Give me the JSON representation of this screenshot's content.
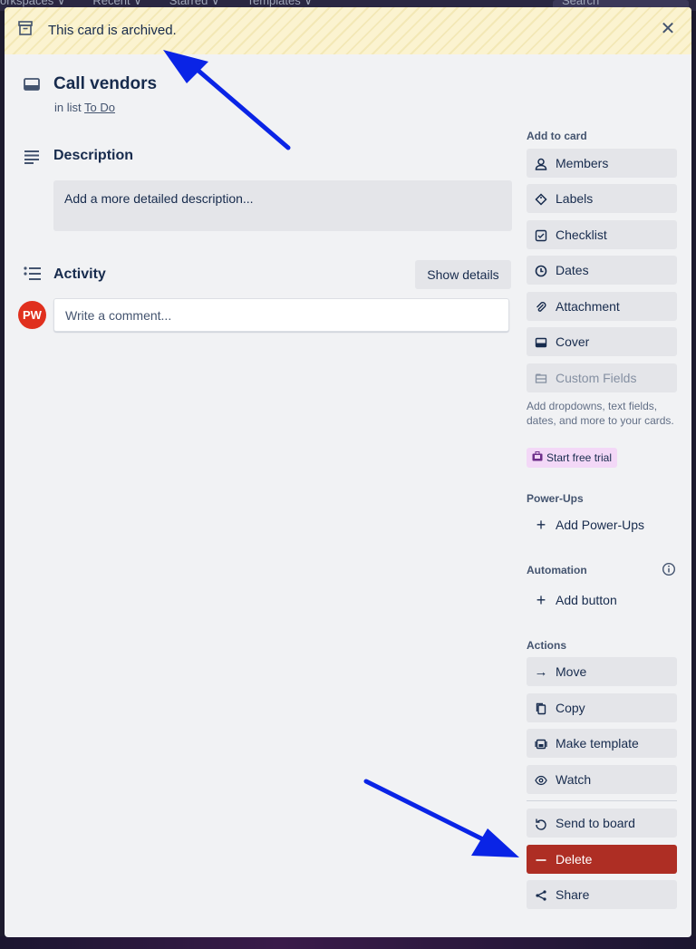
{
  "background": {
    "topbar_items": [
      "orkspaces ∨",
      "Recent ∨",
      "Starred ∨",
      "Templates ∨"
    ],
    "search_placeholder": "Search"
  },
  "banner": {
    "text": "This card is archived."
  },
  "card": {
    "title": "Call vendors",
    "in_list_prefix": "in list",
    "list_name": "To Do"
  },
  "description": {
    "heading": "Description",
    "placeholder": "Add a more detailed description..."
  },
  "activity": {
    "heading": "Activity",
    "show_details": "Show details",
    "avatar_initials": "PW",
    "comment_placeholder": "Write a comment..."
  },
  "sidebar": {
    "add_to_card_label": "Add to card",
    "add_to_card": [
      {
        "label": "Members",
        "icon": "person-icon"
      },
      {
        "label": "Labels",
        "icon": "tag-icon"
      },
      {
        "label": "Checklist",
        "icon": "checklist-icon"
      },
      {
        "label": "Dates",
        "icon": "clock-icon"
      },
      {
        "label": "Attachment",
        "icon": "paperclip-icon"
      },
      {
        "label": "Cover",
        "icon": "cover-icon"
      },
      {
        "label": "Custom Fields",
        "icon": "custom-fields-icon"
      }
    ],
    "custom_fields_note": "Add dropdowns, text fields, dates, and more to your cards.",
    "start_trial": "Start free trial",
    "powerups_label": "Power-Ups",
    "add_powerups": "Add Power-Ups",
    "automation_label": "Automation",
    "add_button": "Add button",
    "actions_label": "Actions",
    "actions": [
      {
        "label": "Move",
        "icon": "arrow-right-icon"
      },
      {
        "label": "Copy",
        "icon": "copy-icon"
      },
      {
        "label": "Make template",
        "icon": "template-icon"
      },
      {
        "label": "Watch",
        "icon": "eye-icon"
      }
    ],
    "archived_actions": [
      {
        "label": "Send to board",
        "icon": "undo-icon"
      },
      {
        "label": "Delete",
        "icon": "minus-icon"
      },
      {
        "label": "Share",
        "icon": "share-icon"
      }
    ]
  },
  "colors": {
    "delete_bg": "#ae2e24",
    "avatar_bg": "#e0301e",
    "annotation_arrow": "#0a24e6",
    "trial_bg": "#f3d8f7"
  }
}
